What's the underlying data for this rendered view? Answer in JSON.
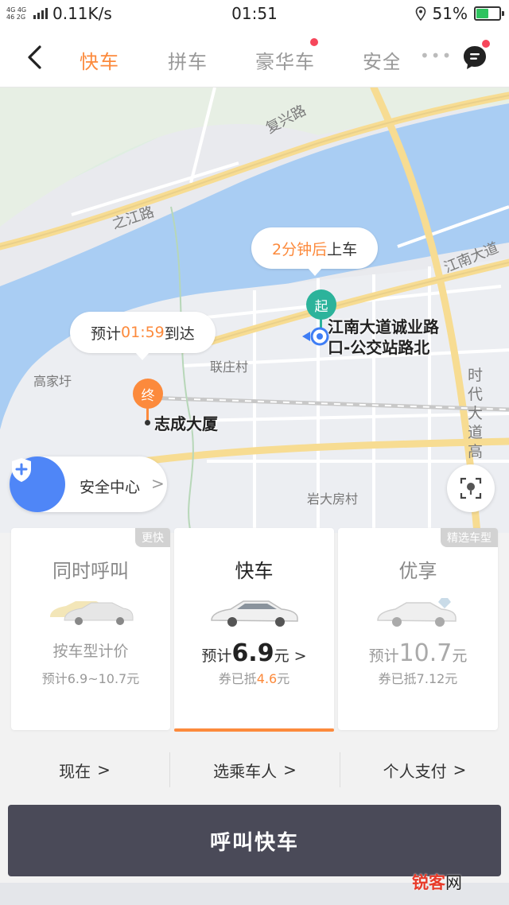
{
  "status_bar": {
    "network_line1": "4G 4G",
    "network_line2": "46 2G",
    "speed": "0.11K/s",
    "time": "01:51",
    "battery": "51%",
    "battery_level": 0.51,
    "battery_color": "#2fc35f"
  },
  "nav": {
    "back_icon": "chevron-left-icon",
    "tabs": [
      {
        "label": "快车",
        "active": true
      },
      {
        "label": "拼车",
        "active": false
      },
      {
        "label": "豪华车",
        "active": false,
        "badge": true
      },
      {
        "label": "安全",
        "active": false
      }
    ],
    "more": "•••",
    "message_icon": "message-icon",
    "accent": "#fc8a3c",
    "badge_color": "#f6465b"
  },
  "map": {
    "roads": {
      "fuxing": "复兴路",
      "zhijiang": "之江路",
      "jiangnan": "江南大道",
      "shidai": "时代大道高"
    },
    "places": {
      "gaojiayu": "高家圩",
      "lianzhuang": "联庄村",
      "yanda": "岩大房村"
    },
    "pickup_bubble": {
      "highlight": "2分钟后",
      "rest": "上车"
    },
    "eta_bubble": {
      "prefix": "预计",
      "time": "01:59",
      "suffix": "到达"
    },
    "start_marker": "起",
    "end_marker": "终",
    "pickup_name_line1": "江南大道诚业路",
    "pickup_name_line2": "口-公交站路北",
    "dest_name": "志成大厦",
    "safety_label": "安全中心",
    "safety_chevron": ">",
    "locate_icon": "locate-icon"
  },
  "cards": [
    {
      "badge": "更快",
      "title": "同时呼叫",
      "line1": "按车型计价",
      "line2": "预计6.9~10.7元"
    },
    {
      "title": "快车",
      "price_prefix": "预计",
      "price": "6.9",
      "price_unit": "元",
      "chevron": ">",
      "coupon_prefix": "券已抵",
      "coupon": "4.6",
      "coupon_unit": "元"
    },
    {
      "badge": "精选车型",
      "title": "优享",
      "price_prefix": "预计",
      "price": "10.7",
      "price_unit": "元",
      "coupon_text": "券已抵7.12元"
    }
  ],
  "options": [
    {
      "label": "现在",
      "chevron": ">"
    },
    {
      "label": "选乘车人",
      "chevron": ">"
    },
    {
      "label": "个人支付",
      "chevron": ">"
    }
  ],
  "call_button": "呼叫快车",
  "watermark": {
    "part1": "锐客",
    "part2": "网"
  }
}
